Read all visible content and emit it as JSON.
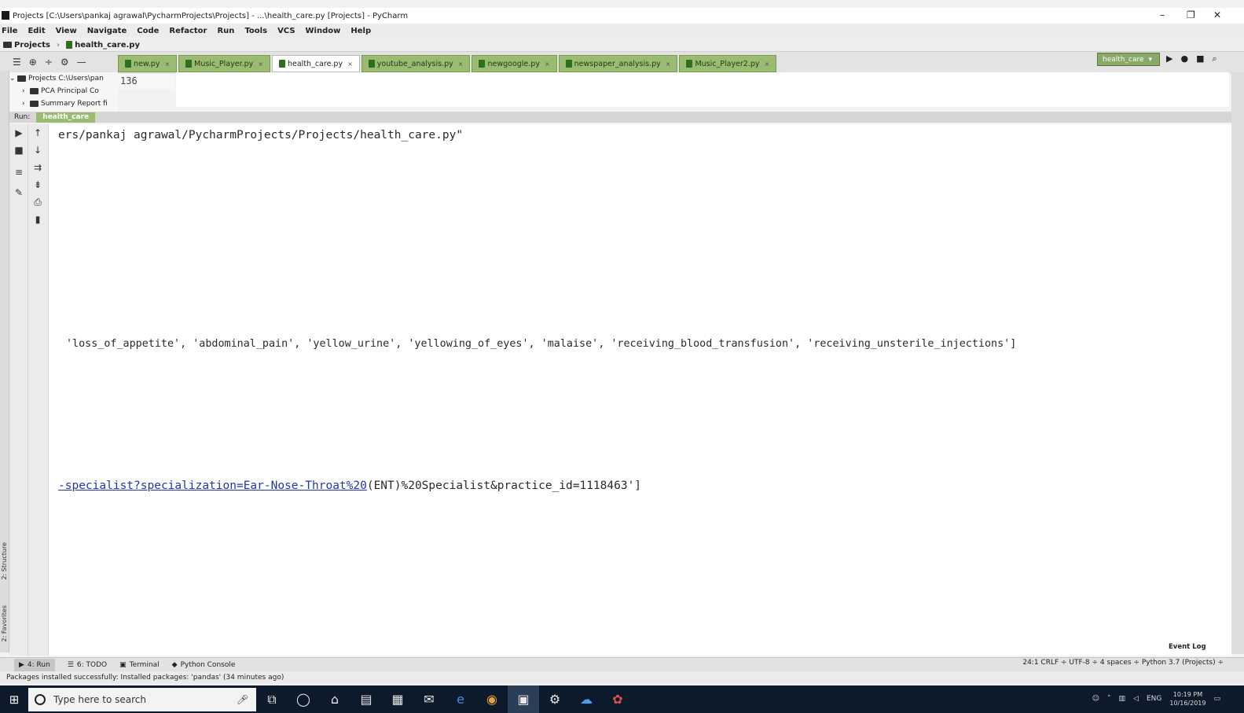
{
  "window": {
    "title": "Projects [C:\\Users\\pankaj agrawal\\PycharmProjects\\Projects] - ...\\health_care.py [Projects] - PyCharm",
    "controls": [
      "–",
      "❐",
      "✕"
    ]
  },
  "menu": [
    "File",
    "Edit",
    "View",
    "Navigate",
    "Code",
    "Refactor",
    "Run",
    "Tools",
    "VCS",
    "Window",
    "Help"
  ],
  "breadcrumb": [
    "Projects",
    "health_care.py"
  ],
  "toolbar": {
    "run_config": "health_care",
    "run_icon": "play-icon",
    "debug_icon": "bug-icon",
    "stop_icon": "stop-icon",
    "search_icon": "search-icon"
  },
  "editor_tabs": [
    {
      "label": "new.py",
      "active": false
    },
    {
      "label": "Music_Player.py",
      "active": false
    },
    {
      "label": "health_care.py",
      "active": true
    },
    {
      "label": "youtube_analysis.py",
      "active": false
    },
    {
      "label": "newgoogle.py",
      "active": false
    },
    {
      "label": "newspaper_analysis.py",
      "active": false
    },
    {
      "label": "Music_Player2.py",
      "active": false
    }
  ],
  "project_tree": [
    {
      "label": "Projects  C:\\Users\\pan",
      "indent": 0,
      "expanded": true
    },
    {
      "label": "PCA   Principal Co",
      "indent": 1,
      "expanded": false
    },
    {
      "label": "Summary Report fi",
      "indent": 1,
      "expanded": false
    }
  ],
  "editor": {
    "line_number": "136"
  },
  "run_panel": {
    "label": "Run:",
    "tab": "health_care"
  },
  "console_lines": {
    "path": "ers/pankaj agrawal/PycharmProjects/Projects/health_care.py\"",
    "symptoms": "'loss_of_appetite', 'abdominal_pain', 'yellow_urine', 'yellowing_of_eyes', 'malaise', 'receiving_blood_transfusion', 'receiving_unsterile_injections']",
    "url_link": "-specialist?specialization=Ear-Nose-Throat%20",
    "url_rest": "(ENT)%20Specialist&practice_id=1118463']"
  },
  "bottom_tabs": [
    {
      "label": "4: Run",
      "active": true
    },
    {
      "label": "6: TODO",
      "active": false
    },
    {
      "label": "Terminal",
      "active": false
    },
    {
      "label": "Python Console",
      "active": false
    }
  ],
  "event_log": "Event Log",
  "status": {
    "message": "Packages installed successfully: Installed packages: 'pandas' (34 minutes ago)",
    "right": "24:1   CRLF ÷   UTF-8 ÷   4 spaces ÷   Python 3.7 (Projects) ÷"
  },
  "taskbar": {
    "search_placeholder": "Type here to search",
    "time": "10:19 PM",
    "date": "10/16/2019",
    "lang": "ENG"
  },
  "side_labels": {
    "structure": "2: Structure",
    "favorites": "2: Favorites"
  }
}
